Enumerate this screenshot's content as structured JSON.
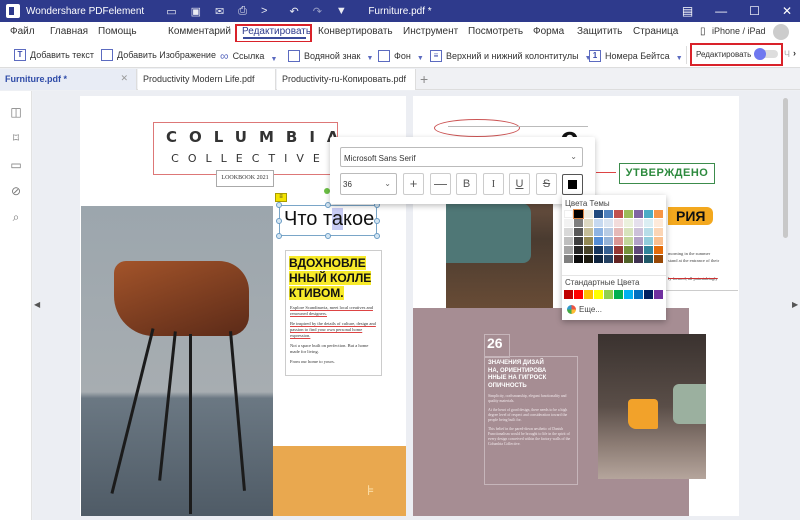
{
  "titlebar": {
    "app_name": "Wondershare PDFelement",
    "file_title": "Furniture.pdf *",
    "quick_access": [
      "folder-icon",
      "save-icon",
      "mail-icon",
      "print-icon",
      "share-icon",
      "undo-icon",
      "redo-icon",
      "customize-icon"
    ],
    "window_buttons": [
      "feedback",
      "minimize",
      "maximize",
      "close"
    ]
  },
  "menu": {
    "items": [
      "Файл",
      "Главная",
      "Помощь",
      "Комментарий",
      "Редактировать",
      "Конвертировать",
      "Инструмент",
      "Посмотреть",
      "Форма",
      "Защитить",
      "Страница"
    ],
    "active": "Редактировать",
    "device": "iPhone / iPad"
  },
  "toolbar": {
    "add_text": "Добавить текст",
    "add_image": "Добавить Изображение",
    "link": "Ссылка",
    "watermark": "Водяной знак",
    "background": "Фон",
    "header_footer": "Верхний и нижний колонтитулы",
    "bates": "Номера Бейтса",
    "edit_toggle_label": "Редактировать",
    "edit_toggle_on": false,
    "overflow": "Ч"
  },
  "tabs": [
    {
      "label": "Furniture.pdf *",
      "active": true
    },
    {
      "label": "Productivity Modern Life.pdf",
      "active": false
    },
    {
      "label": "Productivity-ru-Копировать.pdf",
      "active": false
    }
  ],
  "sidebar": [
    "thumbnails-icon",
    "bookmark-icon",
    "comment-icon",
    "attachment-icon",
    "search-icon"
  ],
  "text_popup": {
    "font": "Microsoft Sans Serif",
    "size": "36",
    "buttons": [
      "+",
      "—",
      "B",
      "I",
      "U",
      "S"
    ]
  },
  "palette": {
    "theme_label": "Цвета Темы",
    "standard_label": "Стандартные Цвета",
    "more_label": "Еще...",
    "theme_top": [
      "#ffffff",
      "#000000",
      "#eeece1",
      "#1f497d",
      "#4f81bd",
      "#c0504d",
      "#9bbb59",
      "#8064a2",
      "#4bacc6",
      "#f79646"
    ],
    "theme_shades": [
      [
        "#f2f2f2",
        "#7f7f7f",
        "#ddd9c3",
        "#c6d9f0",
        "#dbe5f1",
        "#f2dcdb",
        "#ebf1dd",
        "#e5e0ec",
        "#dbeef3",
        "#fdeada"
      ],
      [
        "#d8d8d8",
        "#595959",
        "#c4bd97",
        "#8db3e2",
        "#b8cce4",
        "#e5b9b7",
        "#d7e3bc",
        "#ccc1d9",
        "#b7dde8",
        "#fbd5b5"
      ],
      [
        "#bfbfbf",
        "#3f3f3f",
        "#938953",
        "#548dd4",
        "#95b3d7",
        "#d99694",
        "#c3d69b",
        "#b2a2c7",
        "#92cddc",
        "#fac08f"
      ],
      [
        "#a5a5a5",
        "#262626",
        "#494429",
        "#17365d",
        "#366092",
        "#953734",
        "#76923c",
        "#5f497a",
        "#31859b",
        "#e36c09"
      ],
      [
        "#7f7f7f",
        "#0c0c0c",
        "#1d1b10",
        "#0f243e",
        "#244061",
        "#632423",
        "#4f6128",
        "#3f3151",
        "#205867",
        "#974806"
      ]
    ],
    "standard": [
      "#c00000",
      "#ff0000",
      "#ffc000",
      "#ffff00",
      "#92d050",
      "#00b050",
      "#00b0f0",
      "#0070c0",
      "#002060",
      "#7030a0"
    ]
  },
  "doc": {
    "logo_line1": "COLUMBIA",
    "logo_line2": "COLLECTIVE",
    "lookbook": "LOOKBOOK 2021",
    "edit_text_before": "Что т",
    "edit_text_sel": "а",
    "edit_text_after": "кое",
    "card_heading": [
      "ВДОХНОВЛЕ",
      "ННЫЙ КОЛЛЕ",
      "КТИВОМ."
    ],
    "card_p1": "Explore Scandinavia, meet local creatives and renowned designers.",
    "card_p2": "Be inspired by the details of culture, design and passion to find your own personal home expression.",
    "card_p3": "Not a space built on perfection. But a home made for living.",
    "card_p4": "From our home to yours.",
    "approved": "УТВЕРЖДЕНО",
    "big_e": "e",
    "ria": "РИЯ",
    "right_small1": "morning in the summer",
    "right_small2": "stand at the entrance of their",
    "right_small3": "ly formed, all painstakingly",
    "num": "26",
    "mauve_heading": [
      "ЗНАЧЕНИЯ ДИЗАЙ",
      "НА, ОРИЕНТИРОВА",
      "ННЫЕ НА ГИГРОСК",
      "ОПИЧНОСТЬ"
    ],
    "mauve_p1": "Simplicity, craftsmanship, elegant functionality and quality materials.",
    "mauve_p2": "At the heart of good design, there needs to be a high degree level of respect and consideration toward the people being built for.",
    "mauve_p3": "This belief in the pared-down aesthetic of Danish Functionalism would be brought to life in the spirit of every design conceived within the factory walls of the Columbia Collective."
  }
}
